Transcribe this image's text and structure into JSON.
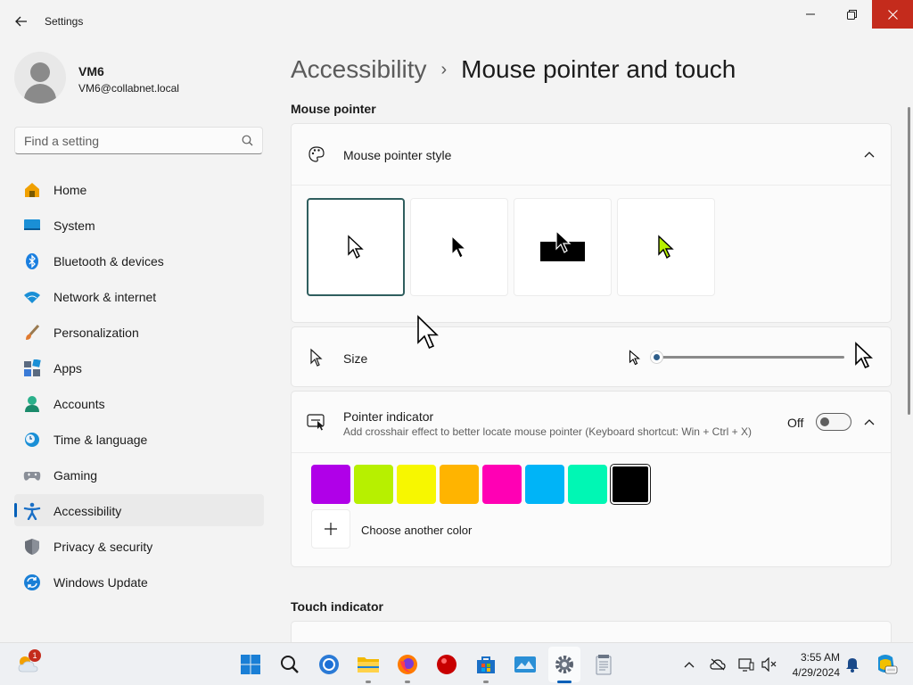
{
  "window": {
    "title": "Settings",
    "controls": {
      "minimize": "minimize",
      "maximize": "restore",
      "close": "close"
    }
  },
  "profile": {
    "name": "VM6",
    "email": "VM6@collabnet.local"
  },
  "search": {
    "placeholder": "Find a setting"
  },
  "nav": {
    "items": [
      {
        "label": "Home",
        "icon": "home-icon"
      },
      {
        "label": "System",
        "icon": "monitor-icon"
      },
      {
        "label": "Bluetooth & devices",
        "icon": "bluetooth-icon"
      },
      {
        "label": "Network & internet",
        "icon": "wifi-icon"
      },
      {
        "label": "Personalization",
        "icon": "brush-icon"
      },
      {
        "label": "Apps",
        "icon": "apps-icon"
      },
      {
        "label": "Accounts",
        "icon": "person-icon"
      },
      {
        "label": "Time & language",
        "icon": "clock-globe-icon"
      },
      {
        "label": "Gaming",
        "icon": "gamepad-icon"
      },
      {
        "label": "Accessibility",
        "icon": "accessibility-icon",
        "active": true
      },
      {
        "label": "Privacy & security",
        "icon": "shield-icon"
      },
      {
        "label": "Windows Update",
        "icon": "refresh-icon"
      }
    ]
  },
  "breadcrumb": {
    "parent": "Accessibility",
    "separator": "›",
    "current": "Mouse pointer and touch"
  },
  "mouse_pointer": {
    "section_title": "Mouse pointer",
    "style": {
      "title": "Mouse pointer style",
      "options": [
        {
          "name": "white",
          "selected": true
        },
        {
          "name": "black",
          "selected": false
        },
        {
          "name": "inverted",
          "selected": false
        },
        {
          "name": "custom",
          "selected": false
        }
      ]
    },
    "size": {
      "title": "Size",
      "value_fraction": 0.0
    },
    "indicator": {
      "title": "Pointer indicator",
      "subtitle": "Add crosshair effect to better locate mouse pointer (Keyboard shortcut: Win + Ctrl + X)",
      "toggle_label": "Off",
      "toggle_on": false,
      "colors": [
        "#b000e8",
        "#b7f000",
        "#f7f700",
        "#ffb400",
        "#ff00b4",
        "#00b4f7",
        "#00f7b4",
        "#000000"
      ],
      "selected_color_index": 7,
      "choose_color_label": "Choose another color"
    }
  },
  "touch": {
    "section_title": "Touch indicator"
  },
  "taskbar": {
    "weather_badge": "1",
    "apps": [
      "start",
      "search",
      "chrome",
      "file-explorer",
      "firefox",
      "record",
      "store",
      "photos",
      "settings",
      "notepad"
    ],
    "clock": {
      "time": "3:55 AM",
      "date": "4/29/2024"
    }
  }
}
